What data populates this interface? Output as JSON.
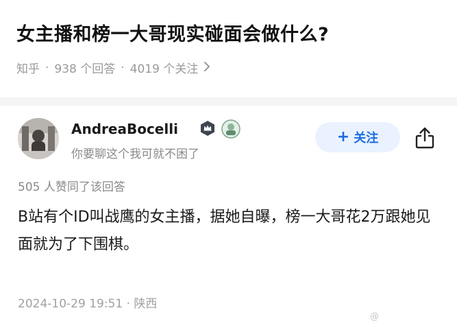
{
  "question": {
    "title": "女主播和榜一大哥现实碰面会做什么?",
    "source": "知乎",
    "answers": "938 个回答",
    "followers": "4019 个关注",
    "chevron_icon": "chevron-right-icon"
  },
  "answer": {
    "author": {
      "name": "AndreaBocelli",
      "bio": "你要聊这个我可就不困了",
      "avatar_icon": "avatar-photo",
      "badges": [
        "crown-badge-icon",
        "achievement-badge-icon"
      ]
    },
    "follow_button": {
      "label": "关注",
      "icon": "plus-icon"
    },
    "share_icon": "share-icon",
    "likes_text": "505 人赞同了该回答",
    "content": "B站有个ID叫战鹰的女主播，据她自曝，榜一大哥花2万跟她见面就为了下围棋。",
    "timestamp": "2024-10-29 19:51 · 陕西"
  },
  "watermark": "@",
  "colors": {
    "accent": "#1a6de0",
    "accent_bg": "#eaf2ff",
    "muted_text": "#8a8a8a",
    "divider": "#f4f4f4"
  }
}
